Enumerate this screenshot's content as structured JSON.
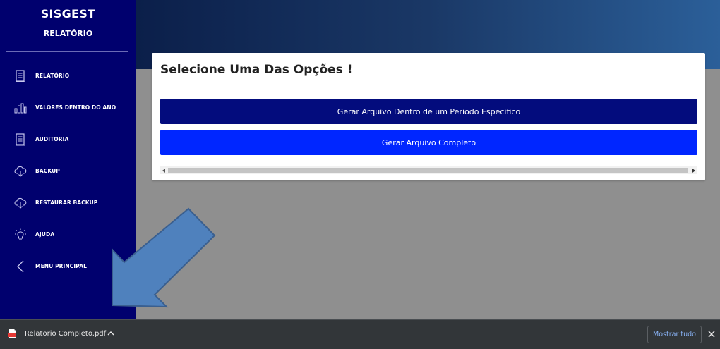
{
  "sidebar": {
    "brand_title": "SISGEST",
    "brand_subtitle": "RELATÓRIO",
    "items": [
      {
        "label": "RELATÓRIO",
        "icon": "document-icon"
      },
      {
        "label": "VALORES DENTRO DO ANO",
        "icon": "bar-chart-icon"
      },
      {
        "label": "AUDITORIA",
        "icon": "document-icon"
      },
      {
        "label": "BACKUP",
        "icon": "cloud-download-icon"
      },
      {
        "label": "RESTAURAR BACKUP",
        "icon": "cloud-download-icon"
      },
      {
        "label": "AJUDA",
        "icon": "lightbulb-icon"
      },
      {
        "label": "MENU PRINCIPAL",
        "icon": "chevron-left-icon"
      }
    ]
  },
  "main": {
    "title": "Selecione Uma Das Opções !",
    "btn_period": "Gerar Arquivo Dentro de um Periodo Especifico",
    "btn_full": "Gerar Arquivo Completo"
  },
  "download_bar": {
    "file_name": "Relatorio Completo.pdf",
    "show_all": "Mostrar tudo"
  },
  "colors": {
    "sidebar": "#00006e",
    "btn_period": "#030c7d",
    "btn_full": "#0026ff",
    "annotation_arrow": "#4f81bd"
  }
}
